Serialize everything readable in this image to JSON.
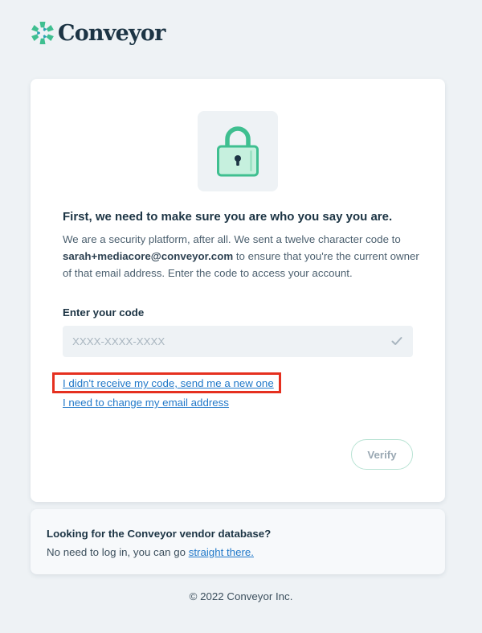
{
  "brand": {
    "name": "Conveyor",
    "accent_color": "#3fbf90",
    "logo_icon": "conveyor-star-icon"
  },
  "card": {
    "icon": "lock-icon",
    "headline": "First, we need to make sure you are who you say you are.",
    "body_before_email": "We are a security platform, after all. We sent a twelve character code to ",
    "email": "sarah+mediacore@conveyor.com",
    "body_after_email": " to ensure that you're the current owner of that email address. Enter the code to access your account.",
    "code_label": "Enter your code",
    "code_placeholder": "XXXX-XXXX-XXXX",
    "code_value": "",
    "resend_link": "I didn't receive my code, send me a new one",
    "change_email_link": "I need to change my email address",
    "verify_label": "Verify"
  },
  "vendor": {
    "title": "Looking for the Conveyor vendor database?",
    "text": "No need to log in, you can go ",
    "link": "straight there."
  },
  "footer": {
    "copyright": "© 2022 Conveyor Inc."
  }
}
